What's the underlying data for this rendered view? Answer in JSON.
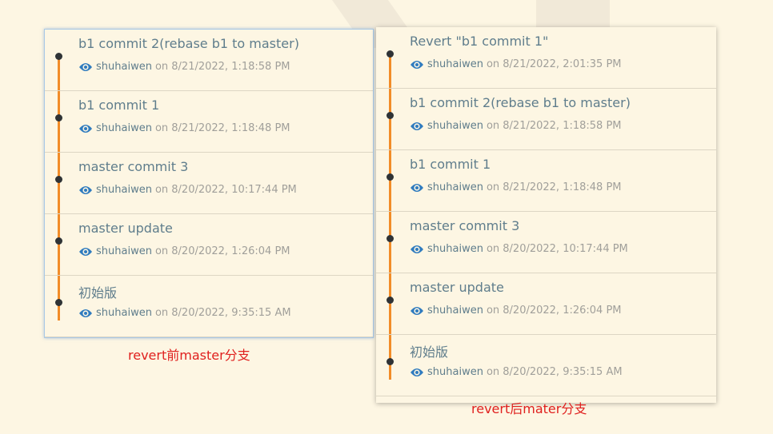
{
  "colors": {
    "background": "#fdf6e3",
    "timeline": "#f28c28",
    "caption": "#e0201e",
    "eye_icon": "#2f7bbf"
  },
  "before": {
    "caption": "revert前master分支",
    "commits": [
      {
        "title": "b1 commit 2(rebase b1 to master)",
        "author": "shuhaiwen",
        "date": "on 8/21/2022, 1:18:58 PM"
      },
      {
        "title": "b1 commit 1",
        "author": "shuhaiwen",
        "date": "on 8/21/2022, 1:18:48 PM"
      },
      {
        "title": "master commit 3",
        "author": "shuhaiwen",
        "date": "on 8/20/2022, 10:17:44 PM"
      },
      {
        "title": "master update",
        "author": "shuhaiwen",
        "date": "on 8/20/2022, 1:26:04 PM"
      },
      {
        "title": "初始版",
        "author": "shuhaiwen",
        "date": "on 8/20/2022, 9:35:15 AM"
      }
    ]
  },
  "after": {
    "caption": "revert后mater分支",
    "commits": [
      {
        "title": "Revert \"b1 commit 1\"",
        "author": "shuhaiwen",
        "date": "on 8/21/2022, 2:01:35 PM"
      },
      {
        "title": "b1 commit 2(rebase b1 to master)",
        "author": "shuhaiwen",
        "date": "on 8/21/2022, 1:18:58 PM"
      },
      {
        "title": "b1 commit 1",
        "author": "shuhaiwen",
        "date": "on 8/21/2022, 1:18:48 PM"
      },
      {
        "title": "master commit 3",
        "author": "shuhaiwen",
        "date": "on 8/20/2022, 10:17:44 PM"
      },
      {
        "title": "master update",
        "author": "shuhaiwen",
        "date": "on 8/20/2022, 1:26:04 PM"
      },
      {
        "title": "初始版",
        "author": "shuhaiwen",
        "date": "on 8/20/2022, 9:35:15 AM"
      }
    ]
  }
}
